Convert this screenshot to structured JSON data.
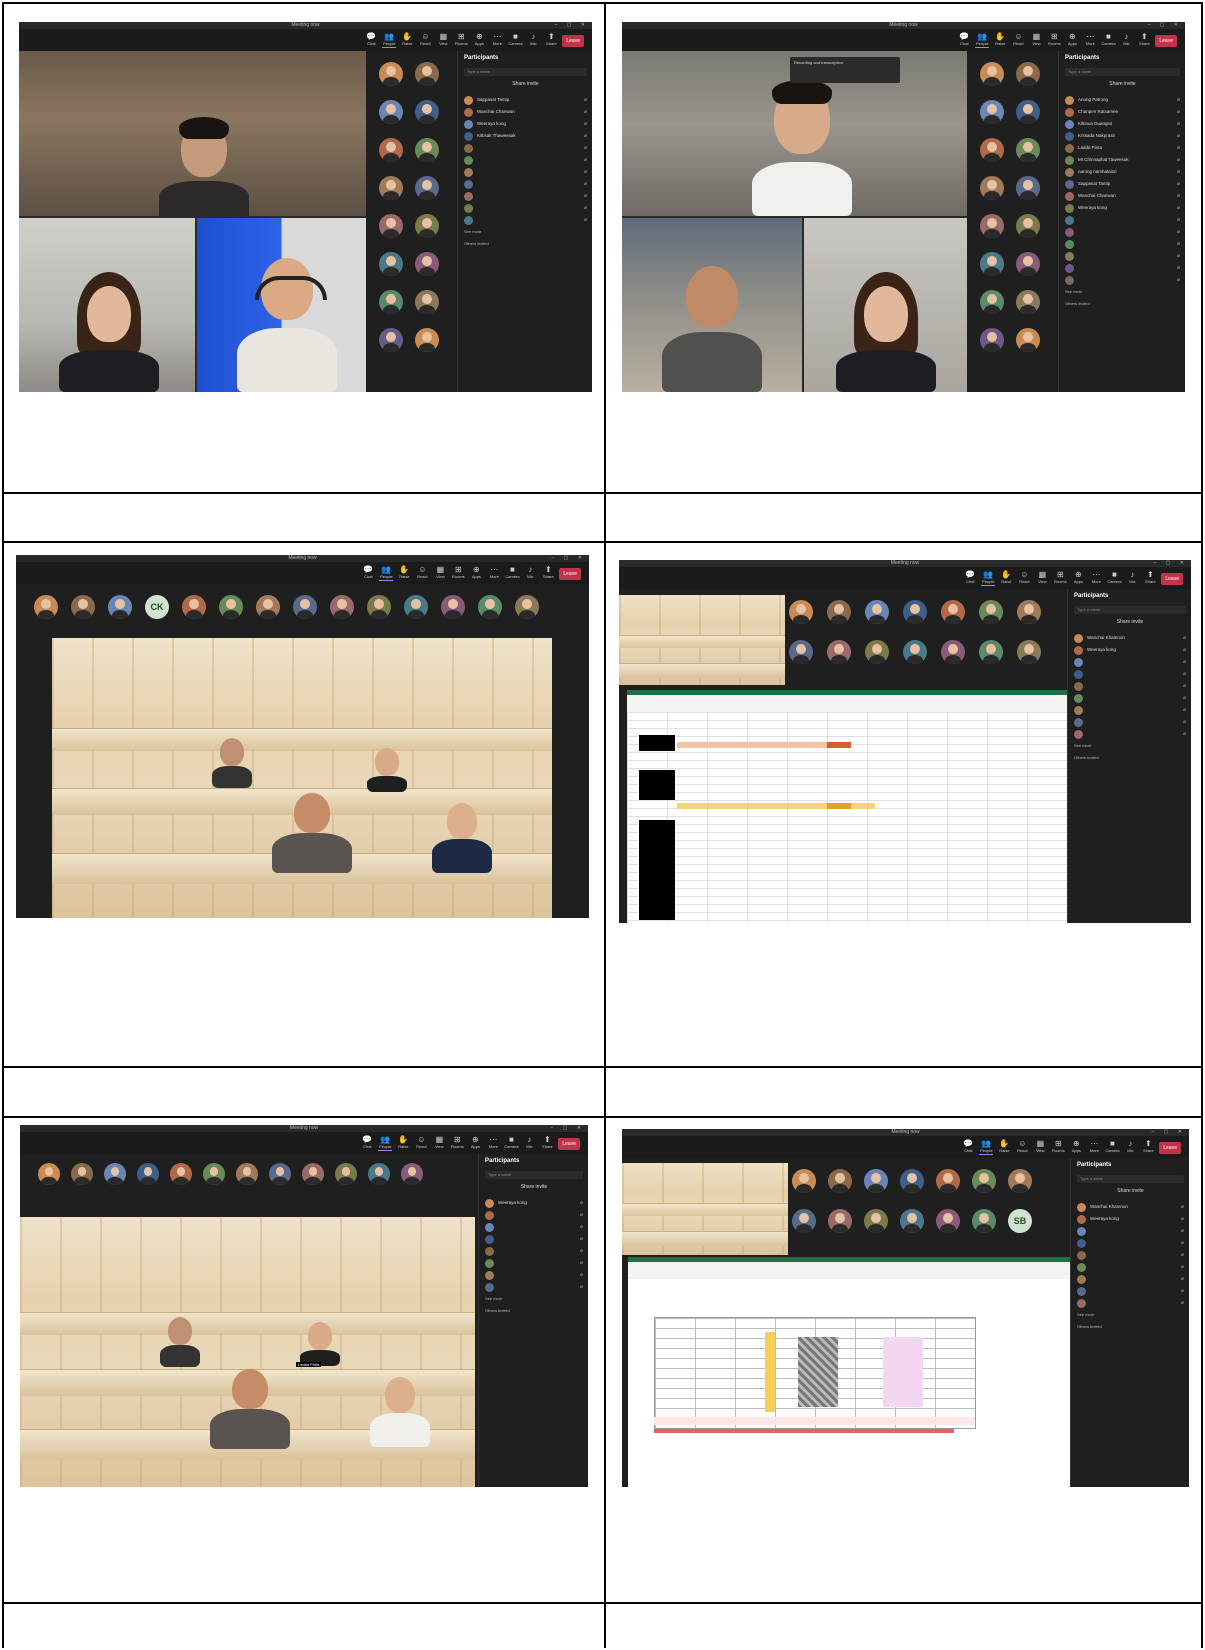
{
  "meeting": {
    "window_title": "Meeting now",
    "timer": "",
    "toolbar": [
      {
        "icon": "chat-icon",
        "label": "Chat"
      },
      {
        "icon": "people-icon",
        "label": "People"
      },
      {
        "icon": "raise-hand-icon",
        "label": "Raise"
      },
      {
        "icon": "react-icon",
        "label": "React"
      },
      {
        "icon": "view-icon",
        "label": "View"
      },
      {
        "icon": "rooms-icon",
        "label": "Rooms"
      },
      {
        "icon": "apps-icon",
        "label": "Apps"
      },
      {
        "icon": "more-icon",
        "label": "More"
      },
      {
        "icon": "camera-icon",
        "label": "Camera"
      },
      {
        "icon": "mic-icon",
        "label": "Mic"
      },
      {
        "icon": "share-icon",
        "label": "Share"
      }
    ],
    "leave_label": "Leave"
  },
  "participants_panel": {
    "title": "Participants",
    "search_placeholder": "Type a name",
    "share_invite": "Share invite",
    "see_more": "See more",
    "others_invited": "Others invited",
    "suggestions": "Suggestions"
  },
  "screens": {
    "s1": {
      "speaker_name": "",
      "tile_a_name": "",
      "tile_b_name": "",
      "participants": [
        {
          "name": "Sappasat Tantip",
          "color": "#c98a54"
        },
        {
          "name": "Wanchai Chanwan",
          "color": "#b06a4a"
        },
        {
          "name": "Weeraya kong",
          "color": "#6a86b8"
        },
        {
          "name": "Kittisak Thaweesak",
          "color": "#3d5f8a"
        },
        {
          "name": "",
          "color": "#8a6a4a"
        },
        {
          "name": "",
          "color": "#6a8a5a"
        },
        {
          "name": "",
          "color": "#a07a5a"
        },
        {
          "name": "",
          "color": "#5a6a8a"
        },
        {
          "name": "",
          "color": "#9a6a6a"
        },
        {
          "name": "",
          "color": "#7a7a4a"
        },
        {
          "name": "",
          "color": "#4a7a8a"
        }
      ]
    },
    "s2": {
      "notice": "Recording and transcription",
      "participants": [
        {
          "name": "Anong Patrong",
          "color": "#c98a54"
        },
        {
          "name": "Chanpen Ratsamee",
          "color": "#b06a4a"
        },
        {
          "name": "Kittinun Duangsri",
          "color": "#6a86b8"
        },
        {
          "name": "Kritsada Nakprasit",
          "color": "#3d5f8a"
        },
        {
          "name": "Ladda Pinta",
          "color": "#8a6a4a"
        },
        {
          "name": "Mr.Chinnaphat Taweesuk",
          "color": "#6a8a5a"
        },
        {
          "name": "narong namhataisri",
          "color": "#a07a5a"
        },
        {
          "name": "Sappasat Tantip",
          "color": "#5a6a8a"
        },
        {
          "name": "Wanchai Chanwan",
          "color": "#9a6a6a"
        },
        {
          "name": "Weeraya kong",
          "color": "#7a7a4a"
        },
        {
          "name": "",
          "color": "#4a7a8a"
        },
        {
          "name": "",
          "color": "#8a5a7a"
        },
        {
          "name": "",
          "color": "#5a8a6a"
        },
        {
          "name": "",
          "color": "#8a7a5a"
        },
        {
          "name": "",
          "color": "#6a5a8a"
        },
        {
          "name": "",
          "color": "#7a6a5a"
        }
      ]
    },
    "s3": {
      "avatar_labels": [
        "",
        "",
        "",
        "CK",
        "",
        "",
        "",
        "",
        "",
        "",
        "",
        "",
        "",
        ""
      ],
      "change_scene": ""
    },
    "s4": {
      "avatar_labels": [
        "",
        "",
        "",
        "",
        "",
        "",
        "",
        "",
        "",
        "",
        "",
        "",
        "",
        "",
        ""
      ],
      "participants": [
        {
          "name": "Wanchai Khamnon",
          "color": "#c98a54"
        },
        {
          "name": "Weeraya kong",
          "color": "#b06a4a"
        },
        {
          "name": "",
          "color": "#6a86b8"
        },
        {
          "name": "",
          "color": "#3d5f8a"
        },
        {
          "name": "",
          "color": "#8a6a4a"
        },
        {
          "name": "",
          "color": "#6a8a5a"
        },
        {
          "name": "",
          "color": "#a07a5a"
        },
        {
          "name": "",
          "color": "#5a6a8a"
        },
        {
          "name": "",
          "color": "#9a6a6a"
        }
      ]
    },
    "s5": {
      "participants": [
        {
          "name": "Weeraya kong",
          "color": "#c98a54"
        },
        {
          "name": "",
          "color": "#b06a4a"
        },
        {
          "name": "",
          "color": "#6a86b8"
        },
        {
          "name": "",
          "color": "#3d5f8a"
        },
        {
          "name": "",
          "color": "#8a6a4a"
        },
        {
          "name": "",
          "color": "#6a8a5a"
        },
        {
          "name": "",
          "color": "#a07a5a"
        },
        {
          "name": "",
          "color": "#5a6a8a"
        }
      ],
      "name_tag": "Ladda Pinta"
    },
    "s6": {
      "avatar_labels": [
        "",
        "",
        "",
        "",
        "",
        "",
        "",
        "",
        "",
        "",
        "",
        "",
        "",
        "SB",
        ""
      ],
      "participants": [
        {
          "name": "Wanchai Khamnon",
          "color": "#c98a54"
        },
        {
          "name": "Weeraya kong",
          "color": "#b06a4a"
        },
        {
          "name": "",
          "color": "#6a86b8"
        },
        {
          "name": "",
          "color": "#3d5f8a"
        },
        {
          "name": "",
          "color": "#8a6a4a"
        },
        {
          "name": "",
          "color": "#6a8a5a"
        },
        {
          "name": "",
          "color": "#a07a5a"
        },
        {
          "name": "",
          "color": "#5a6a8a"
        },
        {
          "name": "",
          "color": "#9a6a6a"
        }
      ],
      "sheet_total_label": "",
      "sheet_red_note": ""
    }
  }
}
